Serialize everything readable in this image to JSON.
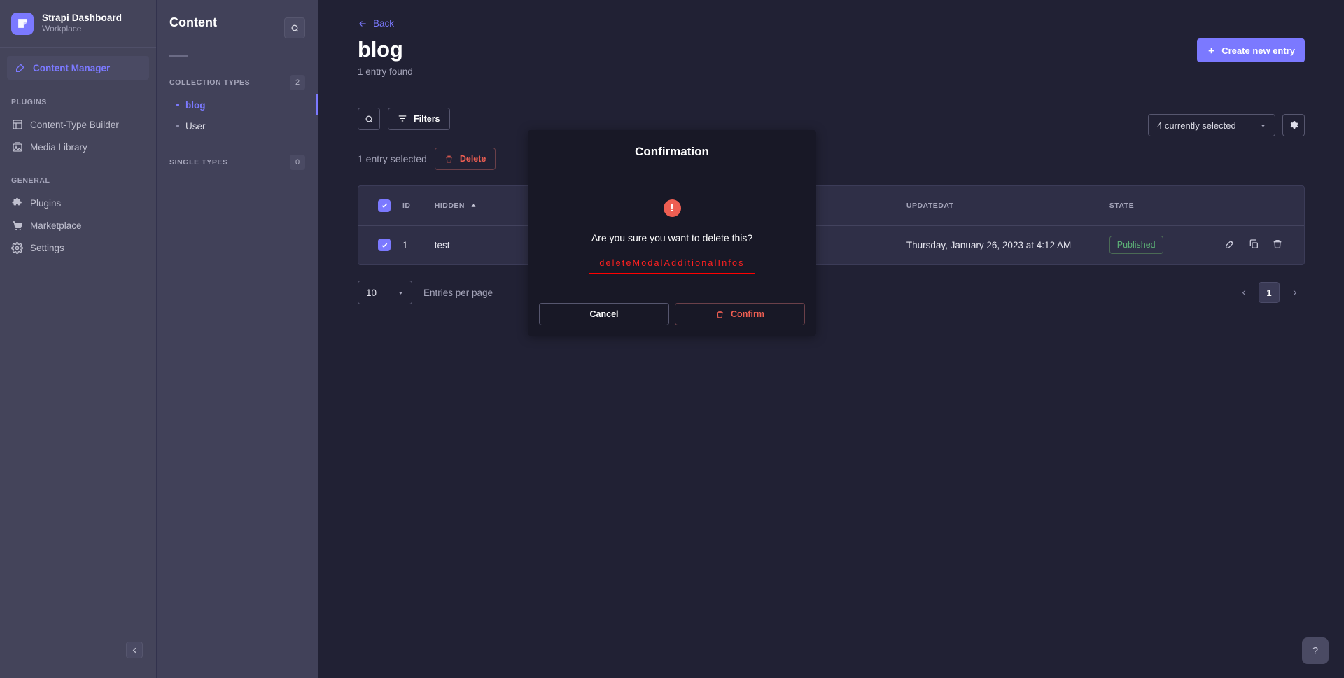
{
  "brand": {
    "title": "Strapi Dashboard",
    "subtitle": "Workplace",
    "logo_icon": "strapi-logo-icon"
  },
  "sidebar": {
    "active_item": {
      "label": "Content Manager",
      "icon": "pencil-square-icon"
    },
    "sections": [
      {
        "label": "PLUGINS",
        "items": [
          {
            "label": "Content-Type Builder",
            "icon": "layout-icon"
          },
          {
            "label": "Media Library",
            "icon": "image-icon"
          }
        ]
      },
      {
        "label": "GENERAL",
        "items": [
          {
            "label": "Plugins",
            "icon": "puzzle-icon"
          },
          {
            "label": "Marketplace",
            "icon": "shopping-cart-icon"
          },
          {
            "label": "Settings",
            "icon": "gear-icon"
          }
        ]
      }
    ],
    "collapse_icon": "chevron-left-icon"
  },
  "content_panel": {
    "title": "Content",
    "search_icon": "search-icon",
    "collection_types": {
      "label": "COLLECTION TYPES",
      "badge": "2",
      "items": [
        {
          "label": "blog",
          "active": true
        },
        {
          "label": "User",
          "active": false
        }
      ]
    },
    "single_types": {
      "label": "SINGLE TYPES",
      "badge": "0",
      "items": []
    }
  },
  "main": {
    "back_label": "Back",
    "back_icon": "arrow-left-icon",
    "page_title": "blog",
    "entries_found": "1 entry found",
    "create_button": {
      "label": "Create new entry",
      "icon": "plus-icon"
    },
    "search_icon": "search-icon",
    "filters_button": {
      "label": "Filters",
      "icon": "filter-icon"
    },
    "field_select": {
      "value": "4 currently selected",
      "chevron_icon": "chevron-down-icon"
    },
    "settings_icon": "gear-icon",
    "selection_text": "1 entry selected",
    "delete_button": {
      "label": "Delete",
      "icon": "trash-icon"
    }
  },
  "table": {
    "columns": [
      {
        "key": "id",
        "label": "ID"
      },
      {
        "key": "hidden",
        "label": "HIDDEN",
        "sorted": true,
        "sort_icon": "caret-up-icon"
      },
      {
        "key": "title",
        "label": ""
      },
      {
        "key": "createdat",
        "label": ""
      },
      {
        "key": "updatedat",
        "label": "UPDATEDAT"
      },
      {
        "key": "state",
        "label": "STATE"
      }
    ],
    "header_checkbox_icon": "check-icon",
    "rows": [
      {
        "checked": true,
        "id": "1",
        "hidden": "test",
        "title": "",
        "createdat": "",
        "updatedat": "Thursday, January 26, 2023 at 4:12 AM",
        "state": "Published",
        "actions": [
          {
            "name": "edit-icon"
          },
          {
            "name": "duplicate-icon"
          },
          {
            "name": "delete-icon"
          }
        ]
      }
    ]
  },
  "footer": {
    "entries_per_page_value": "10",
    "entries_per_page_label": "Entries per page",
    "chevron_icon": "chevron-down-icon",
    "prev_icon": "chevron-left-icon",
    "next_icon": "chevron-right-icon",
    "current_page": "1"
  },
  "modal": {
    "title": "Confirmation",
    "warning_icon": "exclamation-icon",
    "question": "Are you sure you want to delete this?",
    "additional_info": "deleteModalAdditionalInfos",
    "cancel_label": "Cancel",
    "confirm_label": "Confirm",
    "confirm_icon": "trash-icon"
  },
  "help": {
    "label": "?"
  },
  "colors": {
    "accent": "#7b79ff",
    "danger": "#ee5e52",
    "success": "#5cb176",
    "page_bg": "#212134",
    "panel_bg": "#414159",
    "nav_bg": "#44445a",
    "modal_bg": "#181826",
    "highlight_border": "#ff0000"
  }
}
